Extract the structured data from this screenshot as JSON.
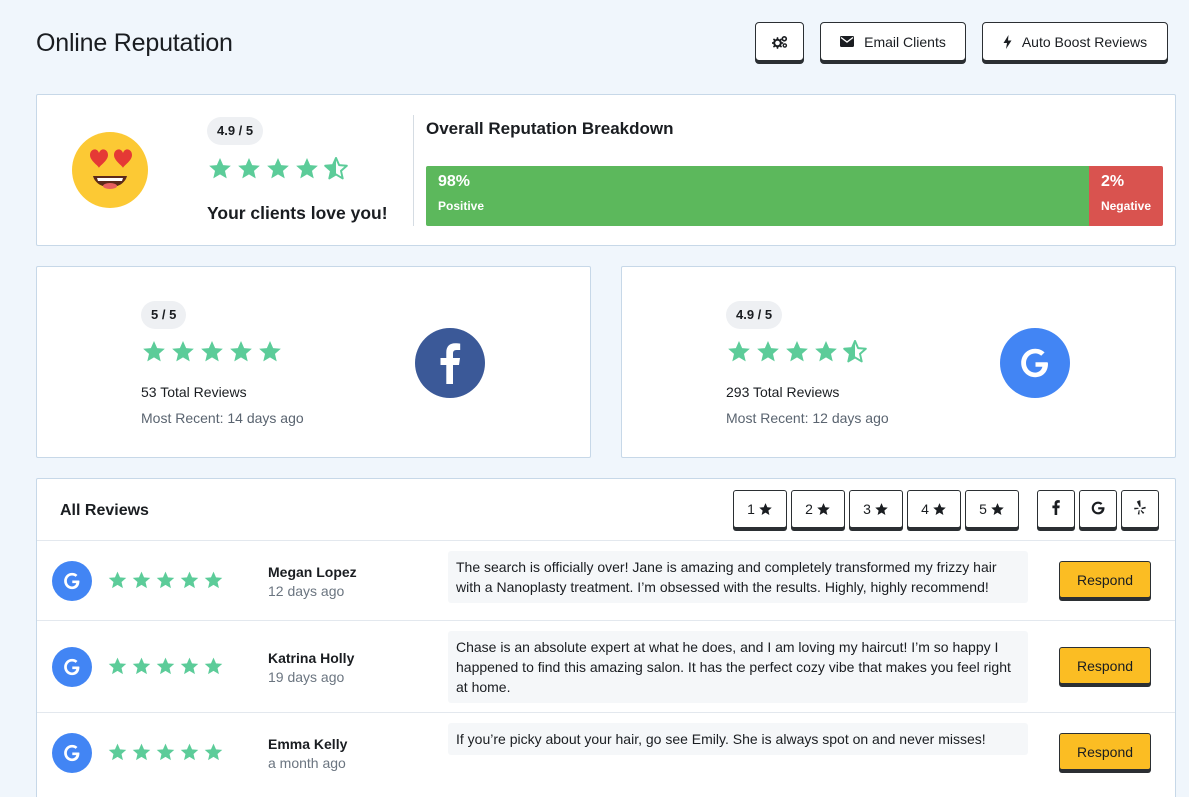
{
  "page": {
    "title": "Online Reputation"
  },
  "actions": {
    "email_label": "Email Clients",
    "boost_label": "Auto Boost Reviews"
  },
  "summary": {
    "rating": "4.9 / 5",
    "stars": 4.5,
    "message": "Your clients love you!",
    "breakdown_title": "Overall Reputation Breakdown",
    "positive": {
      "pct": "98%",
      "label": "Positive",
      "value": 98
    },
    "negative": {
      "pct": "2%",
      "label": "Negative",
      "value": 2
    }
  },
  "sources": {
    "facebook": {
      "rating": "5 / 5",
      "stars": 5,
      "total": "53 Total Reviews",
      "recent": "Most Recent: 14 days ago"
    },
    "google": {
      "rating": "4.9 / 5",
      "stars": 4.5,
      "total": "293 Total Reviews",
      "recent": "Most Recent: 12 days ago"
    }
  },
  "reviews": {
    "title": "All Reviews",
    "filters": [
      "1",
      "2",
      "3",
      "4",
      "5"
    ],
    "respond_label": "Respond",
    "items": [
      {
        "name": "Megan Lopez",
        "date": "12 days ago",
        "stars": 5,
        "text": "The search is officially over! Jane is amazing and completely transformed my frizzy hair with a Nanoplasty treatment. I’m obsessed with the results. Highly, highly recommend!"
      },
      {
        "name": "Katrina Holly",
        "date": "19 days ago",
        "stars": 5,
        "text": "Chase is an absolute expert at what he does, and I am loving my haircut! I’m so happy I happened to find this amazing salon. It has the perfect cozy vibe that makes you feel right at home."
      },
      {
        "name": "Emma Kelly",
        "date": "a month ago",
        "stars": 5,
        "text": "If you’re picky about your hair, go see Emily. She is always spot on and never misses!"
      }
    ]
  },
  "colors": {
    "star": "#5ccc99",
    "positive": "#5cb85c",
    "negative": "#d9534f",
    "facebook": "#3b5998",
    "google": "#4285f4",
    "respond": "#fbbd23"
  }
}
